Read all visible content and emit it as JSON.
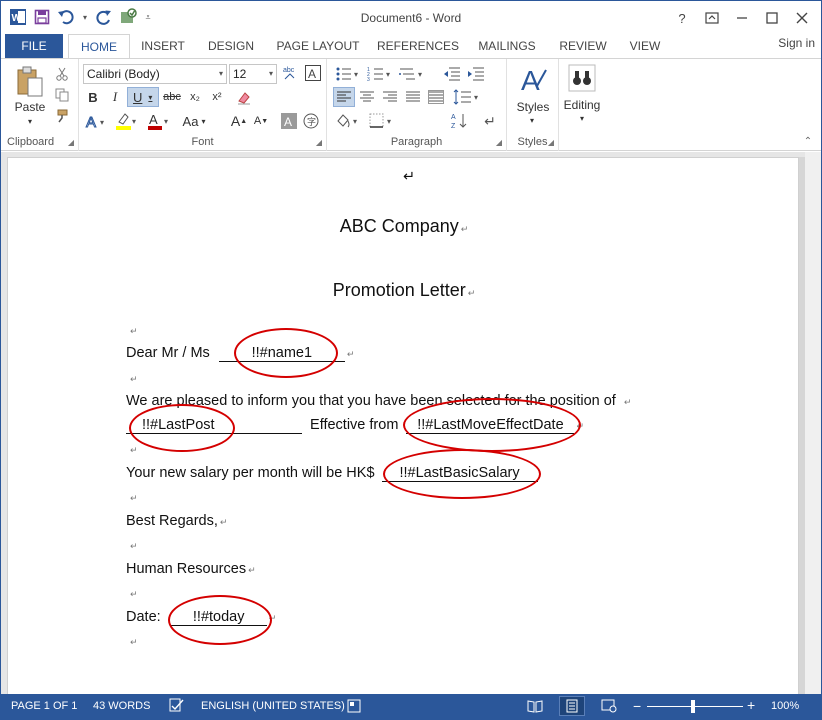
{
  "window": {
    "title": "Document6 - Word",
    "help": "?",
    "sign_in": "Sign in"
  },
  "tabs": [
    "FILE",
    "HOME",
    "INSERT",
    "DESIGN",
    "PAGE LAYOUT",
    "REFERENCES",
    "MAILINGS",
    "REVIEW",
    "VIEW"
  ],
  "ribbon": {
    "clipboard": {
      "label": "Clipboard",
      "paste": "Paste"
    },
    "font": {
      "label": "Font",
      "font_name": "Calibri (Body)",
      "font_size": "12",
      "bold": "B",
      "italic": "I",
      "underline": "U",
      "strike": "abc",
      "subscript": "x₂",
      "superscript": "x²",
      "case": "Aa",
      "grow": "A",
      "shrink": "A"
    },
    "paragraph": {
      "label": "Paragraph"
    },
    "styles": {
      "label": "Styles",
      "button": "Styles"
    },
    "editing": {
      "button": "Editing"
    }
  },
  "document": {
    "company": "ABC Company",
    "heading": "Promotion Letter",
    "dear_prefix": "Dear Mr / Ms",
    "field_name": "!!#name1",
    "body_line1": "We are pleased to inform you that you have been selected for the position of",
    "field_post": "!!#LastPost",
    "effective_from": "Effective from",
    "field_effect_date": "!!#LastMoveEffectDate",
    "salary_prefix": "Your new salary per month will be HK$",
    "field_salary": "!!#LastBasicSalary",
    "regards": "Best Regards,",
    "department": "Human Resources",
    "date_prefix": "Date:",
    "field_today": "!!#today",
    "para_mark": "↵"
  },
  "status": {
    "page": "PAGE 1 OF 1",
    "words": "43 WORDS",
    "language": "ENGLISH (UNITED STATES)",
    "zoom": "100%"
  },
  "colors": {
    "accent": "#2b579a",
    "circle": "#d40000"
  }
}
